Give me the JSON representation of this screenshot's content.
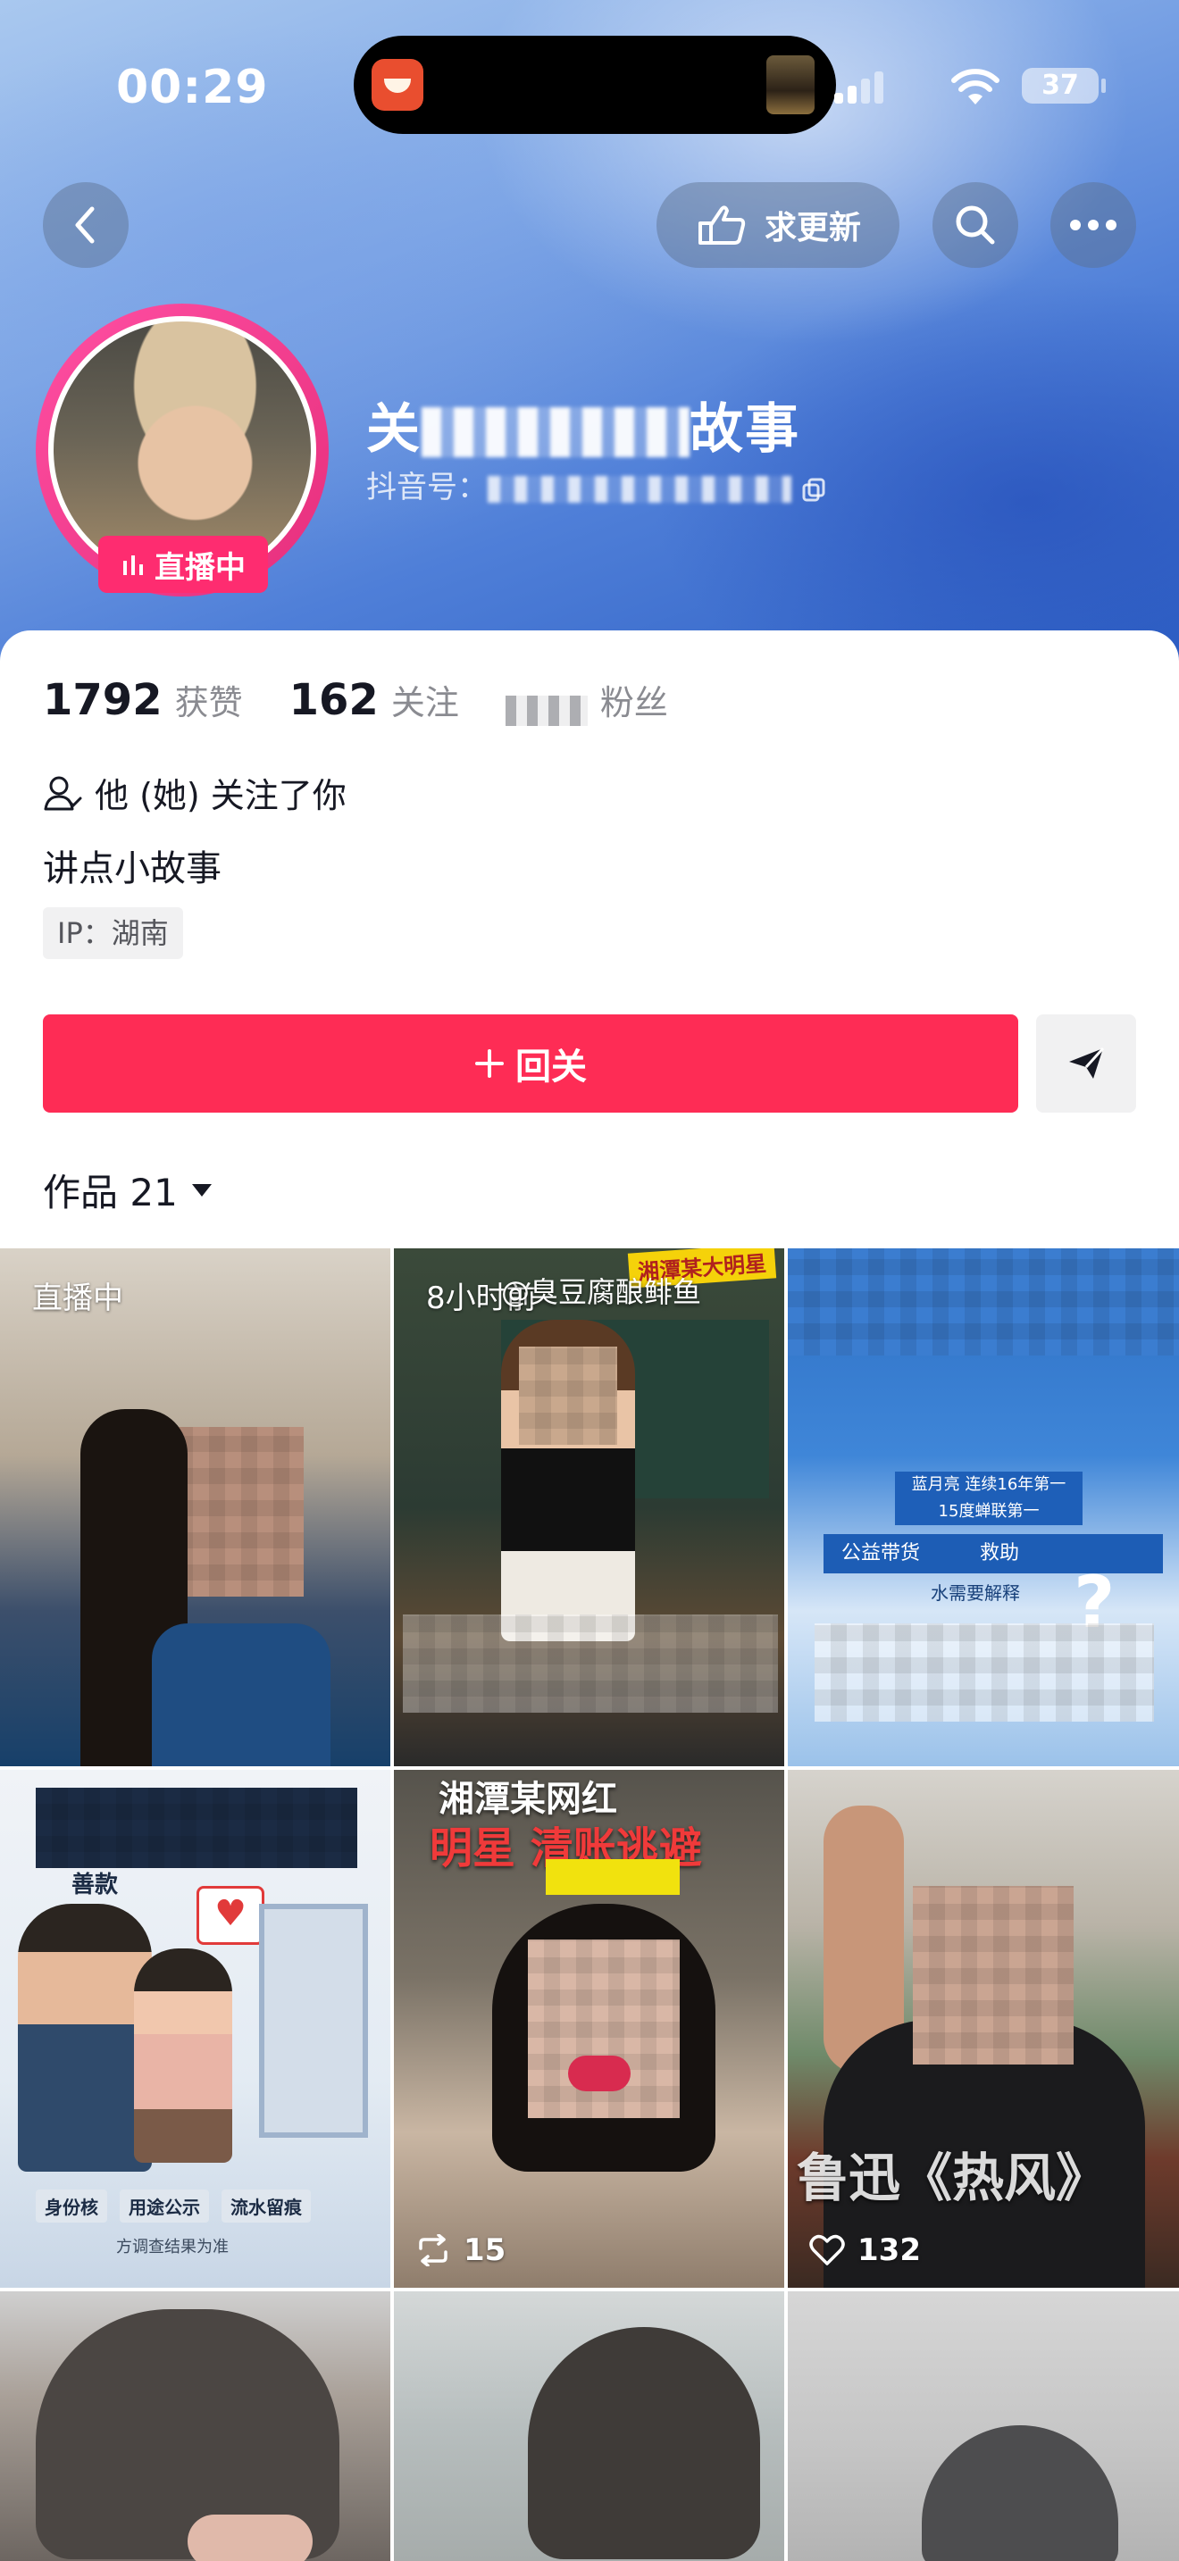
{
  "status_bar": {
    "time": "00:29",
    "battery": "37",
    "icons": [
      "signal-icon",
      "wifi-icon",
      "battery-icon"
    ]
  },
  "header": {
    "back_icon": "chevron-left-icon",
    "update_label": "求更新",
    "update_icon": "pointing-hand-icon",
    "search_icon": "search-icon",
    "more_icon": "more-dots-icon"
  },
  "profile": {
    "name_visible_start": "关",
    "name_visible_end": "故事",
    "id_label": "抖音号：",
    "live_badge": "直播中"
  },
  "stats": {
    "likes_value": "1792",
    "likes_label": "获赞",
    "following_value": "162",
    "following_label": "关注",
    "followers_label": "粉丝"
  },
  "info": {
    "follow_note": "他 (她) 关注了你",
    "bio": "讲点小故事",
    "ip": "IP：湖南",
    "follow_back_label": "回关",
    "works_label": "作品 21"
  },
  "grid": {
    "tiles": [
      {
        "label": "直播中",
        "count": ""
      },
      {
        "label": "8小时前",
        "overlay": "@臭豆腐酿鲱鱼",
        "badge": "湘潭某大明星",
        "count": ""
      },
      {
        "label": "",
        "overlay_lines": [
          "蓝月亮 连续16年第一",
          "15度蝉联第一",
          "公益带货",
          "救助",
          "水需要解释"
        ],
        "count": ""
      },
      {
        "label": "",
        "overlay_lines": [
          "善款",
          "身份核",
          "用途公示",
          "流水留痕",
          "方调查结果为准"
        ],
        "count": ""
      },
      {
        "label": "",
        "overlay_lines": [
          "湘潭某网红",
          "明星 清账逃避"
        ],
        "count": "15"
      },
      {
        "label": "",
        "overlay": "鲁迅《热风》",
        "count": "132"
      },
      {
        "label": "",
        "count": ""
      },
      {
        "label": "",
        "count": ""
      },
      {
        "label": "",
        "count": ""
      }
    ]
  },
  "colors": {
    "accent": "#fe2c55",
    "live": "#fe2c70",
    "text": "#161823",
    "muted": "#8a8b91"
  }
}
